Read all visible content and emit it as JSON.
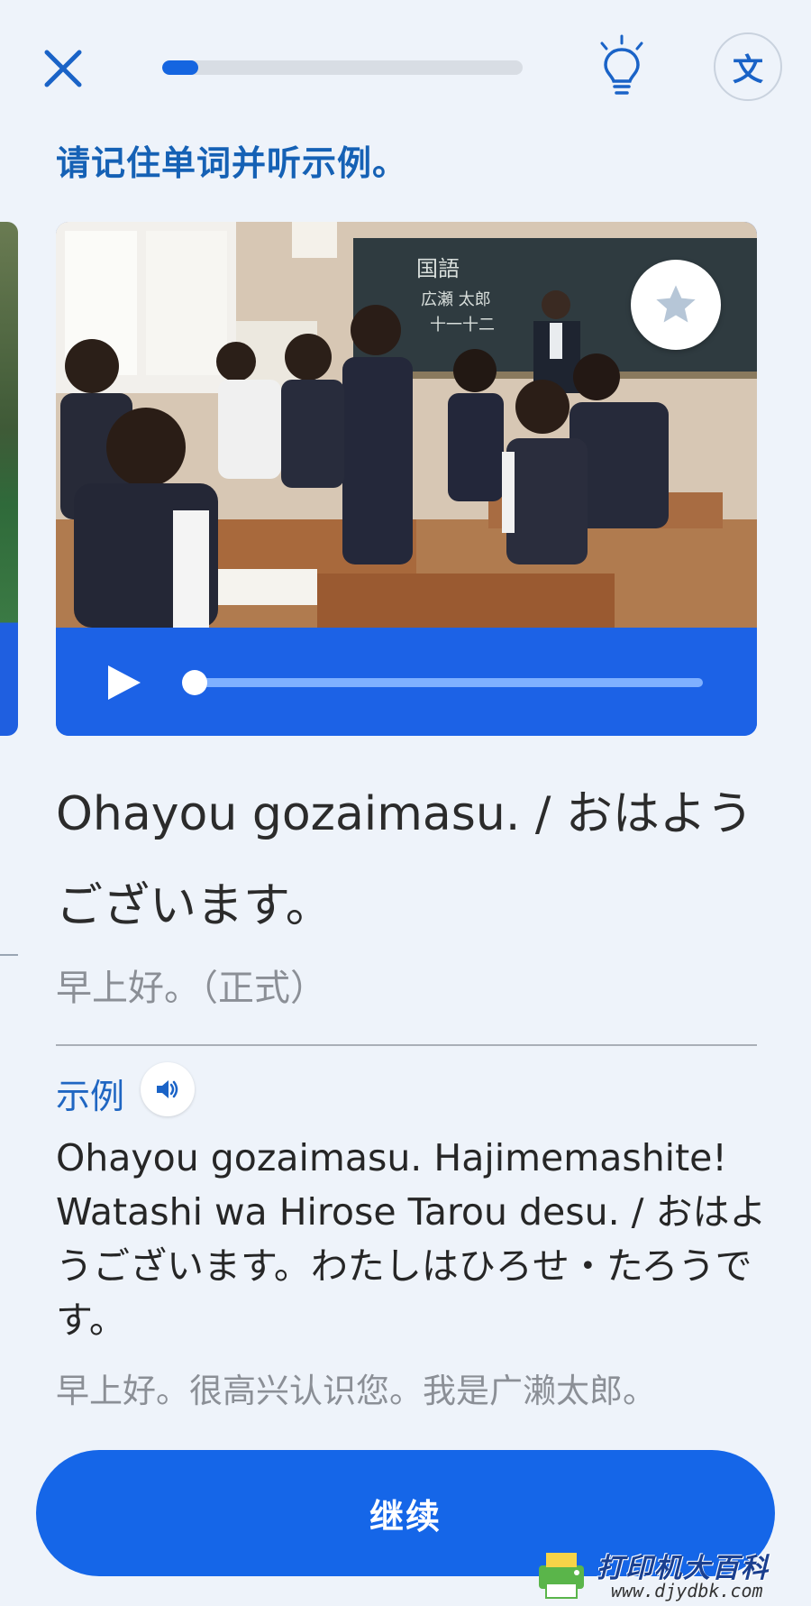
{
  "header": {
    "progress_fraction": 0.1,
    "translate_label": "文"
  },
  "instruction": "请记住单词并听示例。",
  "media": {
    "chalkboard_text": [
      "国語",
      "広瀬 太郎",
      "十一十二"
    ]
  },
  "word": {
    "text": "Ohayou gozaimasu. / おはようございます。",
    "translation": "早上好。（正式）"
  },
  "example": {
    "label": "示例",
    "text": "Ohayou gozaimasu. Hajimemashite! Watashi wa Hirose Tarou desu. / おはようございます。わたしはひろせ・たろうです。",
    "translation": "早上好。很高兴认识您。我是广濑太郎。"
  },
  "continue_label": "继续",
  "watermark": {
    "title": "打印机大百科",
    "url": "www.djydbk.com"
  },
  "colors": {
    "accent": "#1566e8",
    "title_blue": "#1561b5",
    "background": "#eef3fa"
  }
}
